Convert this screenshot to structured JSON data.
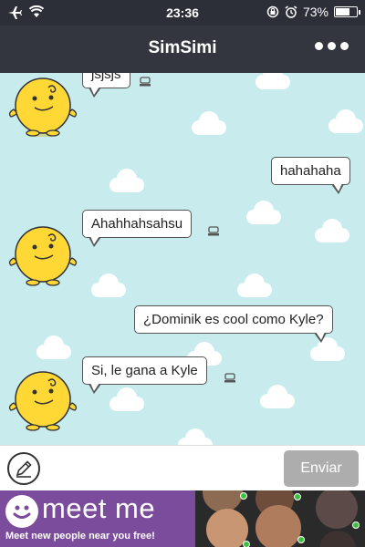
{
  "status_bar": {
    "time": "23:36",
    "battery": "73%",
    "battery_level": 0.73
  },
  "nav": {
    "title": "SimSimi"
  },
  "chat": {
    "messages": [
      {
        "sender": "bot",
        "text": "jsjsjs"
      },
      {
        "sender": "user",
        "text": "hahahaha"
      },
      {
        "sender": "bot",
        "text": "Ahahhahsahsu"
      },
      {
        "sender": "user",
        "text": "¿Dominik es cool como Kyle?"
      },
      {
        "sender": "bot",
        "text": "Si, le gana a Kyle"
      }
    ]
  },
  "input": {
    "value": "",
    "placeholder": "",
    "send_label": "Enviar"
  },
  "ad": {
    "brand": "meet me",
    "tagline": "Meet new people near you free!"
  },
  "colors": {
    "chat_background": "#c8ecee",
    "nav_background": "#33353f",
    "ad_purple": "#7b4b9c",
    "send_button": "#adadad"
  }
}
